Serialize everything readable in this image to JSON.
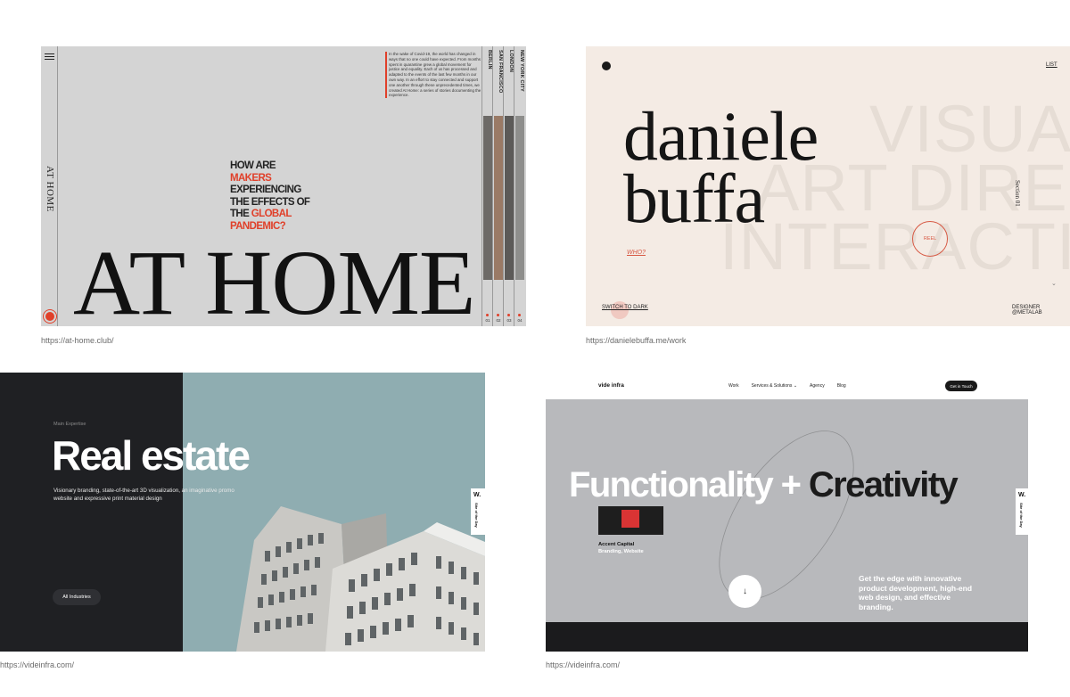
{
  "card1": {
    "url": "https://at-home.club/",
    "side_title": "AT HOME",
    "intro_text": "In the wake of Covid-19, the world has changed in ways that no one could have expected. From months spent in quarantine grew a global movement for justice and equality. Each of us has processed and adapted to the events of the last few months in our own way. In an effort to stay connected and support one another through these unprecedented times, we created At Home: a series of stories documenting the experience.",
    "headline_parts": [
      "HOW ARE ",
      "MAKERS",
      " EXPERIENCING THE EFFECTS OF THE ",
      "GLOBAL PANDEMIC?"
    ],
    "big_title": "AT HOME",
    "cities": [
      {
        "name": "BERLIN",
        "num": "01",
        "photo": "#6d6a67"
      },
      {
        "name": "SAN FRANCISCO",
        "num": "02",
        "photo": "#9a7a66"
      },
      {
        "name": "LONDON",
        "num": "03",
        "photo": "#5c5a58"
      },
      {
        "name": "NEW YORK CITY",
        "num": "04",
        "photo": "#8e8e8c"
      }
    ],
    "accent": "#e0402a"
  },
  "card2": {
    "url": "https://danielebuffa.me/work",
    "name_line1": "daniele",
    "name_line2": "buffa",
    "bg_words": [
      "VISUAL",
      "ART DIRECTION",
      "INTERACTION"
    ],
    "list_link": "LIST",
    "who_link": "WHO?",
    "reel_label": "REEL",
    "section_label": "Section 01",
    "switch_label": "SWITCH TO DARK",
    "designer_label": "DESIGNER @METALAB",
    "accent": "#d75a45"
  },
  "card3": {
    "url": "https://videinfra.com/",
    "eyebrow": "Main Expertise",
    "title": "Real estate",
    "description": "Visionary branding, state-of-the-art 3D visualization, an imaginative promo website and expressive print material design",
    "button_label": "All Industries",
    "badge_w": "W.",
    "badge_text": "Site of the Day"
  },
  "card4": {
    "url": "https://videinfra.com/",
    "logo": "vide infra",
    "nav_items": [
      "Work",
      "Services & Solutions ⌄",
      "Agency",
      "Blog"
    ],
    "cta_label": "Get in Touch",
    "headline_light": "Functionality + ",
    "headline_dark": "Creativity",
    "client_name": "Accent Capital",
    "client_sub": "Branding, Website",
    "pitch": "Get the edge with innovative product development, high-end web design, and effective branding.",
    "scroll_icon": "↓",
    "badge_w": "W.",
    "badge_text": "Site of the Day"
  }
}
